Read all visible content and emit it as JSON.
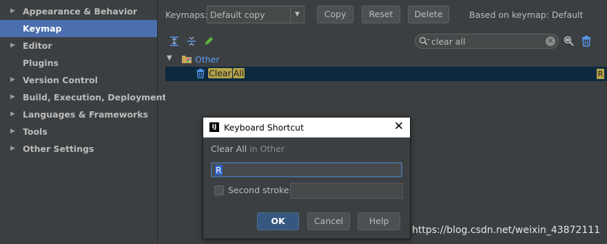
{
  "sidebar": {
    "items": [
      {
        "label": "Appearance & Behavior",
        "arrow": "▶"
      },
      {
        "label": "Keymap",
        "arrow": ""
      },
      {
        "label": "Editor",
        "arrow": "▶"
      },
      {
        "label": "Plugins",
        "arrow": ""
      },
      {
        "label": "Version Control",
        "arrow": "▶"
      },
      {
        "label": "Build, Execution, Deployment",
        "arrow": "▶"
      },
      {
        "label": "Languages & Frameworks",
        "arrow": "▶"
      },
      {
        "label": "Tools",
        "arrow": "▶"
      },
      {
        "label": "Other Settings",
        "arrow": "▶"
      }
    ],
    "selected_index": 1
  },
  "toolbar": {
    "keymaps_label": "Keymaps:",
    "keymap_value": "Default copy",
    "copy_label": "Copy",
    "reset_label": "Reset",
    "delete_label": "Delete",
    "based_on": "Based on keymap: Default"
  },
  "search": {
    "value": "clear all",
    "clear_glyph": "×"
  },
  "tree": {
    "group": {
      "caret": "▼",
      "label": "Other"
    },
    "action": {
      "part1": "Clear",
      "part2": "All",
      "shortcut": "R"
    }
  },
  "dialog": {
    "logo": "IJ",
    "title": "Keyboard Shortcut",
    "close_glyph": "✕",
    "action_name": "Clear All",
    "action_context": "in Other",
    "key_value": "R",
    "second_stroke_label": "Second stroke:",
    "ok_label": "OK",
    "cancel_label": "Cancel",
    "help_label": "Help"
  },
  "watermark": "https://blog.csdn.net/weixin_43872111",
  "colors": {
    "selection": "#4b6eaf",
    "tree_selection": "#0d293e",
    "match_highlight": "#b2a34b",
    "link": "#589df6"
  }
}
